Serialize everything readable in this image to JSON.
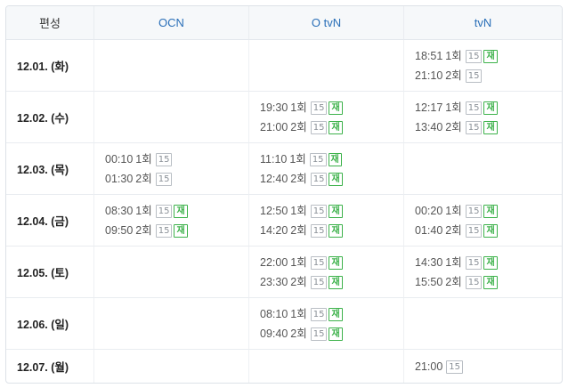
{
  "header": {
    "date_col": "편성",
    "channels": [
      "OCN",
      "O tvN",
      "tvN"
    ]
  },
  "rating_label": "15",
  "rerun_label": "재",
  "rows": [
    {
      "date": "12.01. (화)",
      "cells": [
        [],
        [],
        [
          {
            "time": "18:51",
            "ep": "1회",
            "rerun": true
          },
          {
            "time": "21:10",
            "ep": "2회",
            "rerun": false
          }
        ]
      ]
    },
    {
      "date": "12.02. (수)",
      "cells": [
        [],
        [
          {
            "time": "19:30",
            "ep": "1회",
            "rerun": true
          },
          {
            "time": "21:00",
            "ep": "2회",
            "rerun": true
          }
        ],
        [
          {
            "time": "12:17",
            "ep": "1회",
            "rerun": true
          },
          {
            "time": "13:40",
            "ep": "2회",
            "rerun": true
          }
        ]
      ]
    },
    {
      "date": "12.03. (목)",
      "cells": [
        [
          {
            "time": "00:10",
            "ep": "1회",
            "rerun": false
          },
          {
            "time": "01:30",
            "ep": "2회",
            "rerun": false
          }
        ],
        [
          {
            "time": "11:10",
            "ep": "1회",
            "rerun": true
          },
          {
            "time": "12:40",
            "ep": "2회",
            "rerun": true
          }
        ],
        []
      ]
    },
    {
      "date": "12.04. (금)",
      "cells": [
        [
          {
            "time": "08:30",
            "ep": "1회",
            "rerun": true
          },
          {
            "time": "09:50",
            "ep": "2회",
            "rerun": true
          }
        ],
        [
          {
            "time": "12:50",
            "ep": "1회",
            "rerun": true
          },
          {
            "time": "14:20",
            "ep": "2회",
            "rerun": true
          }
        ],
        [
          {
            "time": "00:20",
            "ep": "1회",
            "rerun": true
          },
          {
            "time": "01:40",
            "ep": "2회",
            "rerun": true
          }
        ]
      ]
    },
    {
      "date": "12.05. (토)",
      "cells": [
        [],
        [
          {
            "time": "22:00",
            "ep": "1회",
            "rerun": true
          },
          {
            "time": "23:30",
            "ep": "2회",
            "rerun": true
          }
        ],
        [
          {
            "time": "14:30",
            "ep": "1회",
            "rerun": true
          },
          {
            "time": "15:50",
            "ep": "2회",
            "rerun": true
          }
        ]
      ]
    },
    {
      "date": "12.06. (일)",
      "cells": [
        [],
        [
          {
            "time": "08:10",
            "ep": "1회",
            "rerun": true
          },
          {
            "time": "09:40",
            "ep": "2회",
            "rerun": true
          }
        ],
        []
      ]
    },
    {
      "date": "12.07. (월)",
      "cells": [
        [],
        [],
        [
          {
            "time": "21:00",
            "ep": "",
            "rerun": false
          }
        ]
      ]
    }
  ]
}
